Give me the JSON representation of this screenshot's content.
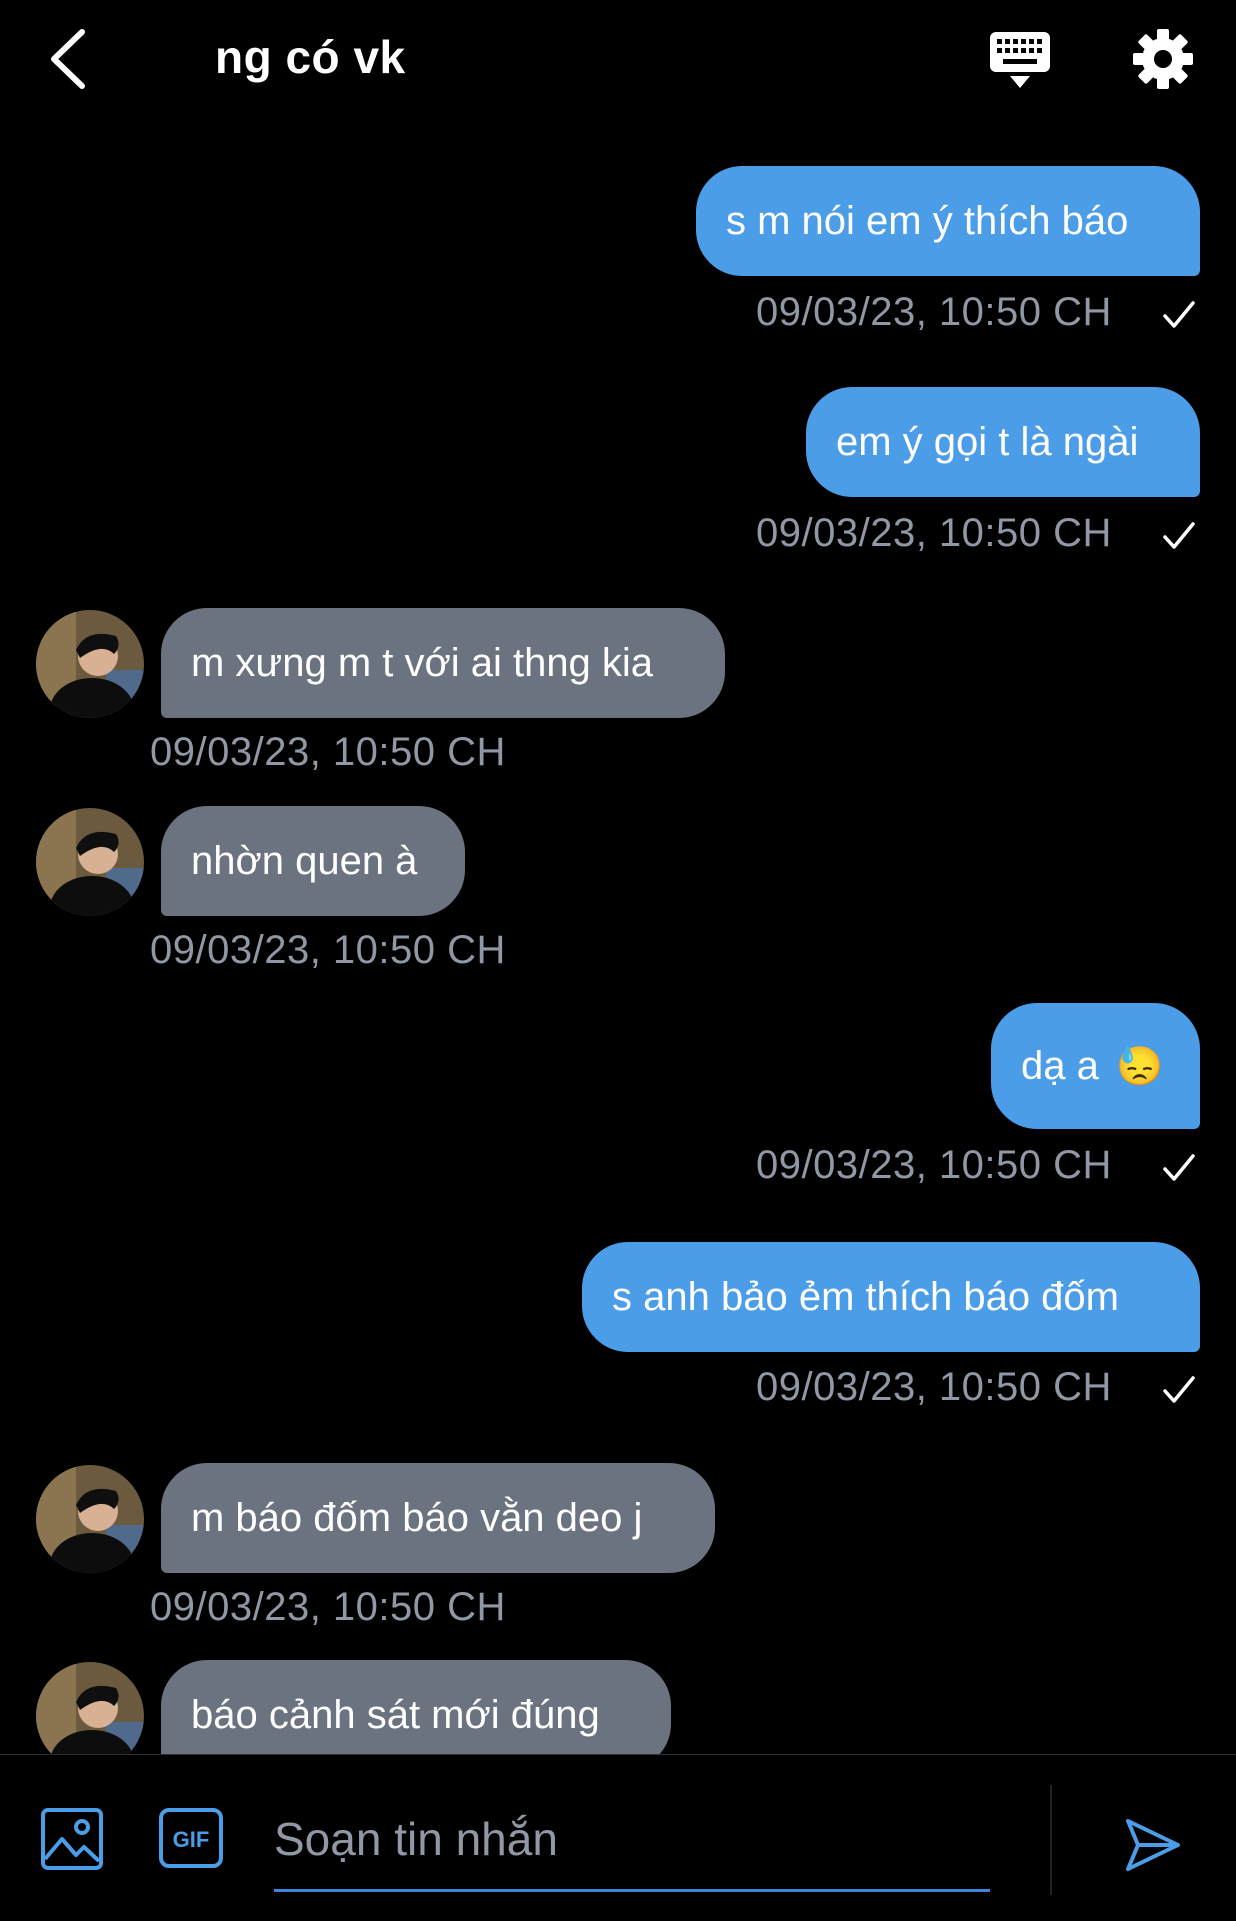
{
  "header": {
    "title": "ng có vk"
  },
  "messages": [
    {
      "direction": "out",
      "text": "s m nói em ý thích báo",
      "time": "09/03/23, 10:50 CH"
    },
    {
      "direction": "out",
      "text": "em ý gọi t là ngài",
      "time": "09/03/23, 10:50 CH"
    },
    {
      "direction": "in",
      "text": "m xưng m t với ai thng kia",
      "time": "09/03/23, 10:50 CH"
    },
    {
      "direction": "in",
      "text": "nhờn quen à",
      "time": "09/03/23, 10:50 CH"
    },
    {
      "direction": "out",
      "text": "dạ a",
      "emoji": "😓",
      "time": "09/03/23, 10:50 CH"
    },
    {
      "direction": "out",
      "text": "s anh bảo ẻm thích báo đốm",
      "time": "09/03/23, 10:50 CH"
    },
    {
      "direction": "in",
      "text": "m báo đốm báo vằn deo j",
      "time": "09/03/23, 10:50 CH"
    },
    {
      "direction": "in",
      "text": "báo cảnh sát mới đúng",
      "time": ""
    }
  ],
  "composer": {
    "placeholder": "Soạn tin nhắn"
  },
  "colors": {
    "outgoing_bubble": "#4a9de6",
    "incoming_bubble": "#6b7381",
    "timestamp": "#8f98a4",
    "accent": "#3b84d6"
  },
  "icons": [
    "back-chevron-icon",
    "keyboard-icon",
    "gear-icon",
    "image-icon",
    "gif-icon",
    "send-icon",
    "checkmark-icon"
  ]
}
